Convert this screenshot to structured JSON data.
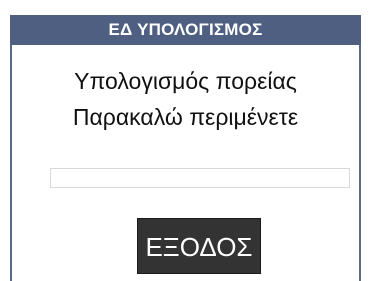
{
  "dialog": {
    "title": "ΕΔ ΥΠΟΛΟΓΙΣΜΟΣ",
    "message_line1": "Υπολογισμός πορείας",
    "message_line2": "Παρακαλώ περιμένετε",
    "progress": 0,
    "exit_label": "ΕΞΟΔΟΣ"
  },
  "colors": {
    "title_bar": "#4e5f82",
    "button_bg": "#333333",
    "button_text": "#ffffff"
  }
}
